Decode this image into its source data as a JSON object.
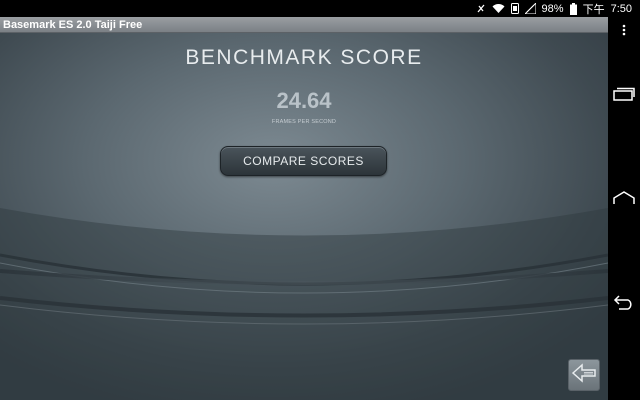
{
  "status_bar": {
    "battery": "98%",
    "time_period": "下午",
    "time": "7:50",
    "icons": [
      "notification-icon",
      "wifi-icon",
      "nfc-icon",
      "signal-icon",
      "battery-icon"
    ]
  },
  "app": {
    "title": "Basemark ES 2.0 Taiji Free"
  },
  "score": {
    "heading": "BENCHMARK SCORE",
    "value": "24.64",
    "unit": "FRAMES PER SECOND"
  },
  "buttons": {
    "compare_label": "COMPARE SCORES",
    "back_icon": "back-arrow-icon"
  },
  "nav_bar": {
    "items": [
      "menu-icon",
      "recent-apps-icon",
      "home-icon",
      "back-icon"
    ]
  },
  "colors": {
    "background_center": "#7d8a92",
    "background_edge": "#343e45",
    "title_bar": "#8a8e92"
  }
}
